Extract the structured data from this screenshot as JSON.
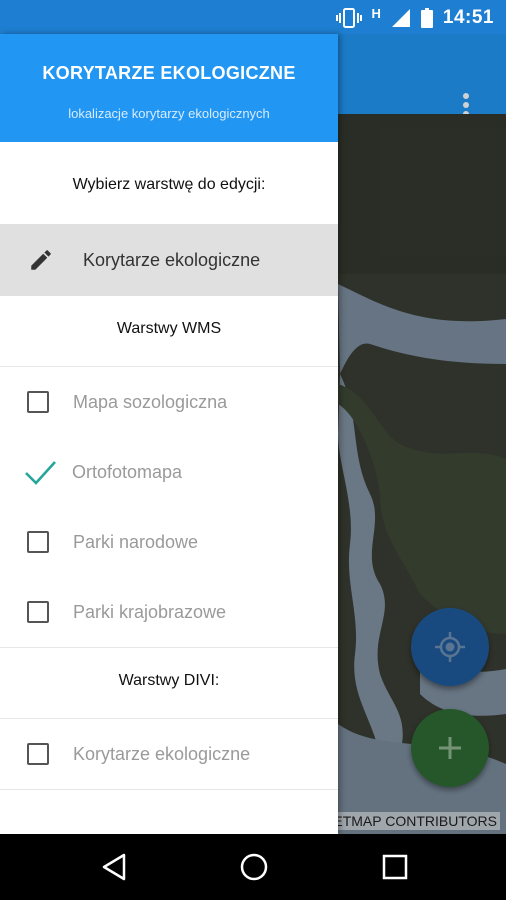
{
  "status_bar": {
    "time": "14:51",
    "network": "H"
  },
  "drawer": {
    "title": "KORYTARZE EKOLOGICZNE",
    "subtitle": "lokalizacje korytarzy ekologicznych",
    "choose_layer_label": "Wybierz warstwę do edycji:",
    "selected_layer": "Korytarze ekologiczne",
    "wms_section_label": "Warstwy WMS",
    "wms_layers": [
      {
        "label": "Mapa sozologiczna",
        "checked": false
      },
      {
        "label": "Ortofotomapa",
        "checked": true
      },
      {
        "label": "Parki narodowe",
        "checked": false
      },
      {
        "label": "Parki krajobrazowe",
        "checked": false
      }
    ],
    "divi_section_label": "Warstwy DIVI:",
    "divi_layers": [
      {
        "label": "Korytarze ekologiczne",
        "checked": false
      }
    ]
  },
  "map": {
    "attribution": "ETMAP CONTRIBUTORS"
  },
  "colors": {
    "primary": "#2196f3",
    "status_bar": "#1e7fd2",
    "check": "#26a69a",
    "fab_location": "#1f5b9c",
    "fab_add": "#2e6b34"
  }
}
